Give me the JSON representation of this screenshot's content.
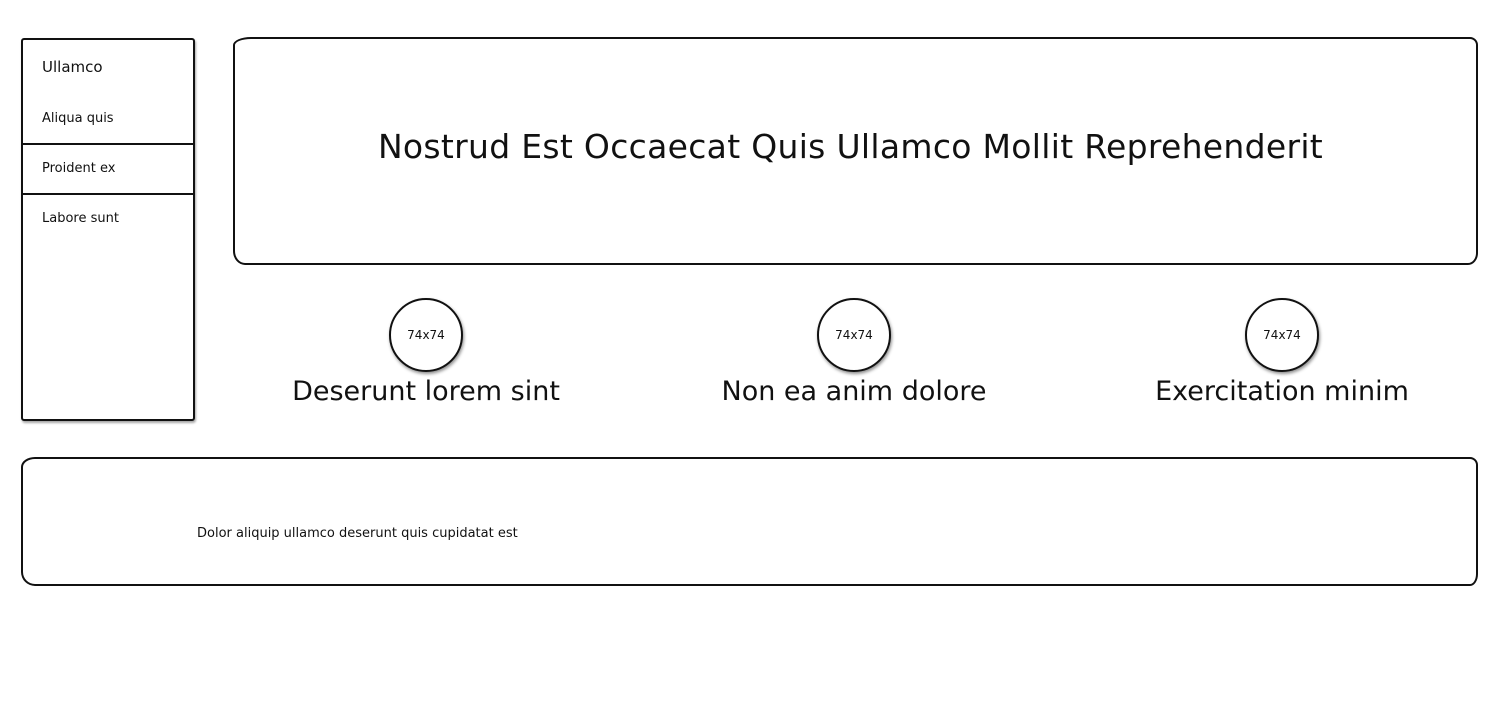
{
  "sidebar": {
    "title": "Ullamco",
    "items": [
      {
        "label": "Aliqua quis"
      },
      {
        "label": "Proident ex"
      },
      {
        "label": "Labore sunt"
      }
    ]
  },
  "hero": {
    "title": "Nostrud Est Occaecat Quis Ullamco Mollit Reprehenderit"
  },
  "features": [
    {
      "image_label": "74x74",
      "title": "Deserunt lorem sint"
    },
    {
      "image_label": "74x74",
      "title": "Non ea anim dolore"
    },
    {
      "image_label": "74x74",
      "title": "Exercitation minim"
    }
  ],
  "footer": {
    "text": "Dolor aliquip ullamco deserunt quis cupidatat est"
  },
  "colors": {
    "border": "#111111",
    "background": "#ffffff"
  }
}
